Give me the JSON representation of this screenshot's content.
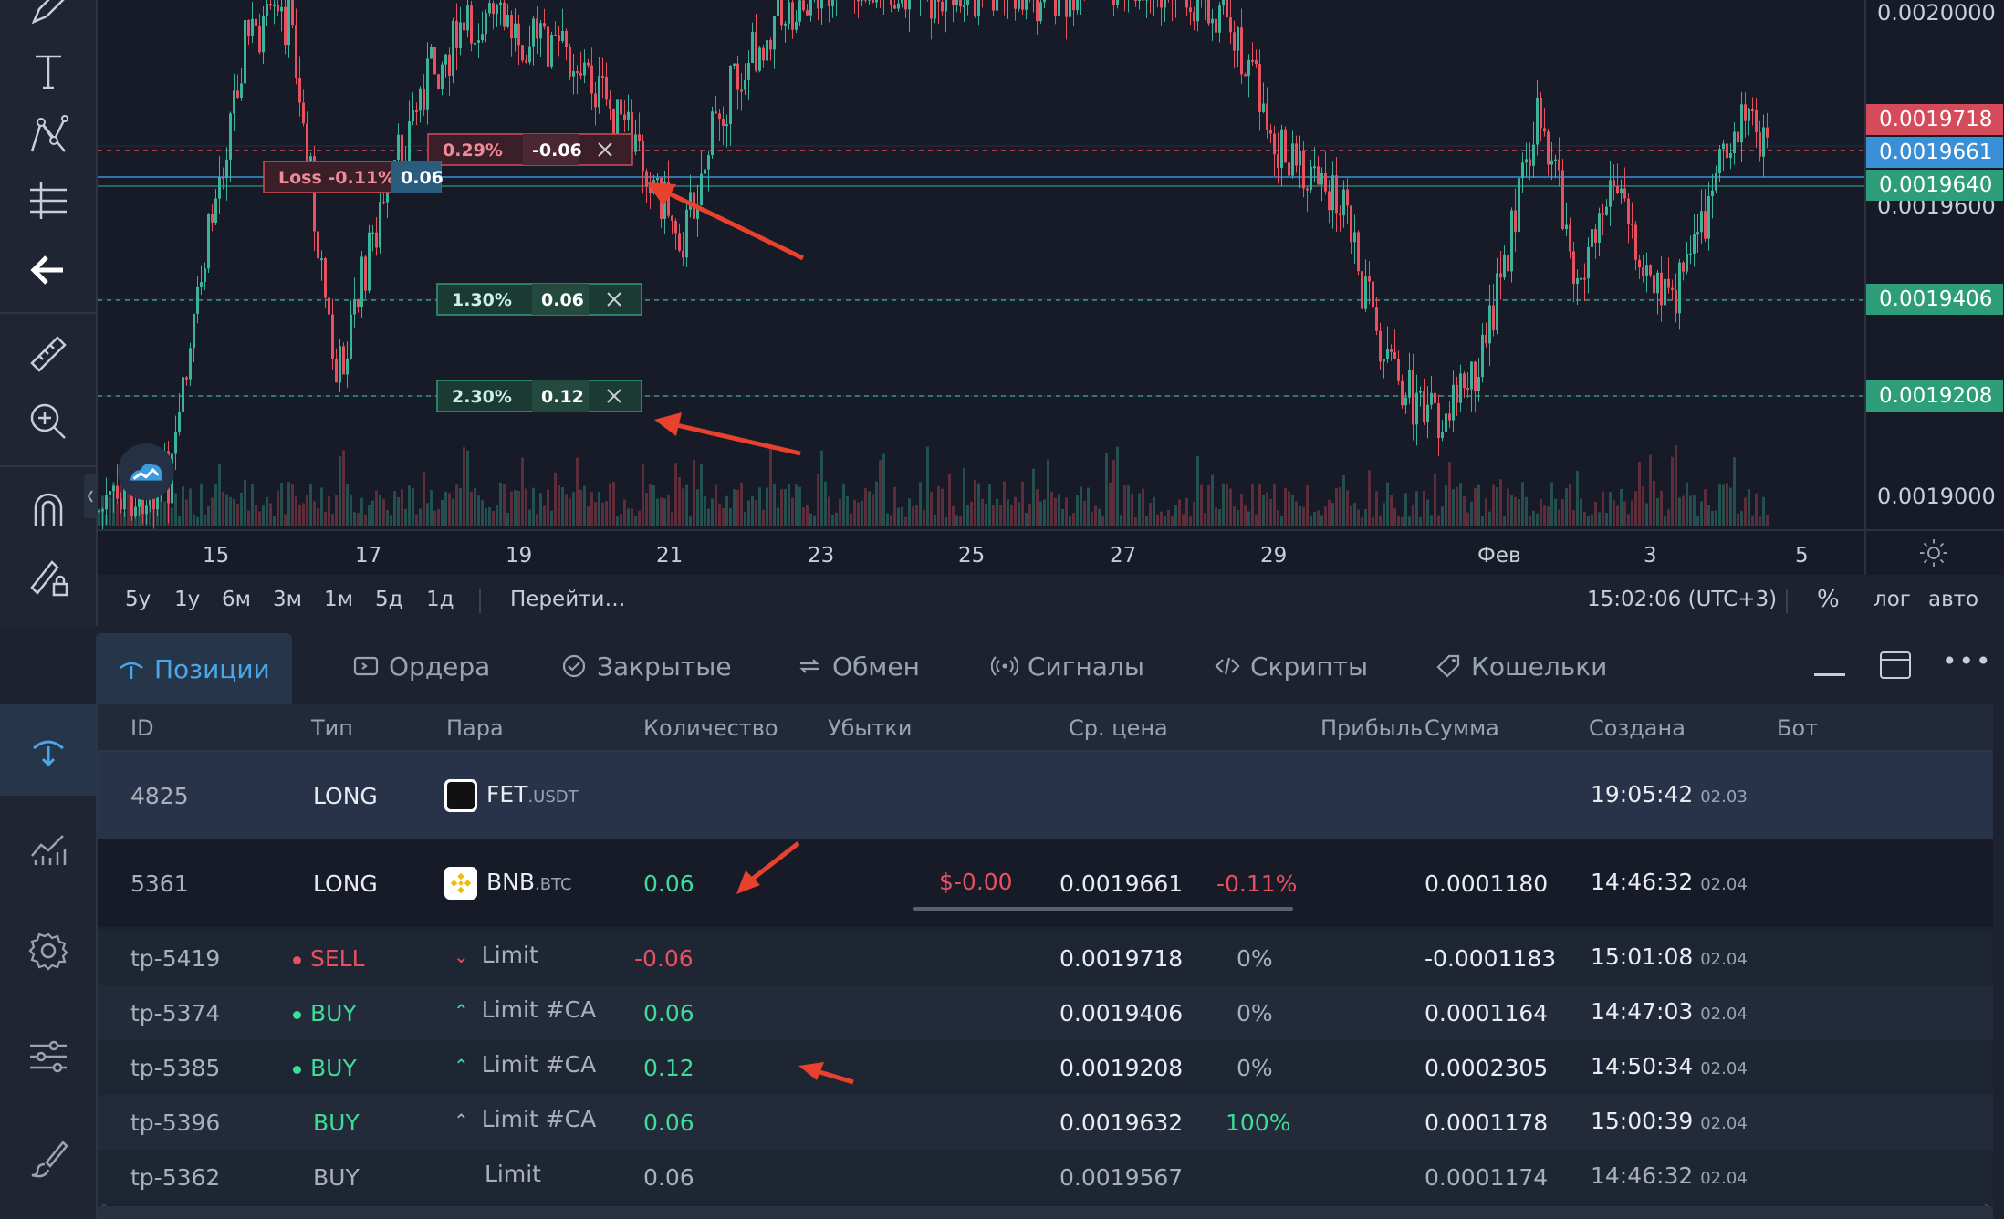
{
  "chart": {
    "price_labels": [
      "0.0020000",
      "0.0019600",
      "0.0019000"
    ],
    "price_tags": [
      {
        "value": "0.0019718",
        "color": "#d64b5b"
      },
      {
        "value": "0.0019661",
        "color": "#3a8fd6"
      },
      {
        "value": "0.0019640",
        "color": "#2e9e7a"
      },
      {
        "value": "0.0019406",
        "color": "#2e9e7a"
      },
      {
        "value": "0.0019208",
        "color": "#2e9e7a"
      }
    ],
    "time_labels": [
      "15",
      "17",
      "19",
      "21",
      "23",
      "25",
      "27",
      "29",
      "Фев",
      "3",
      "5"
    ],
    "orders": [
      {
        "pct": "0.29%",
        "qty": "-0.06",
        "kind": "sell"
      },
      {
        "pct": "Loss -0.11%",
        "qty": "0.06",
        "kind": "loss"
      },
      {
        "pct": "1.30%",
        "qty": "0.06",
        "kind": "tp"
      },
      {
        "pct": "2.30%",
        "qty": "0.12",
        "kind": "tp"
      }
    ],
    "colors": {
      "up": "#3bb39a",
      "down": "#e6505f",
      "bg": "#161b27"
    }
  },
  "rangebar": {
    "ranges": [
      "5y",
      "1y",
      "6м",
      "3м",
      "1м",
      "5д",
      "1д"
    ],
    "goto": "Перейти…",
    "time": "15:02:06 (UTC+3)",
    "percent": "%",
    "log": "лог",
    "auto": "авто"
  },
  "tabs": [
    "Позиции",
    "Ордера",
    "Закрытые",
    "Обмен",
    "Сигналы",
    "Скрипты",
    "Кошельки"
  ],
  "table": {
    "headers": [
      "ID",
      "Тип",
      "Пара",
      "Количество",
      "Убытки",
      "Ср. цена",
      "Прибыль",
      "Сумма",
      "Создана",
      "Бот"
    ],
    "positions": [
      {
        "id": "4825",
        "type": "LONG",
        "pair": "FET",
        "quote": ".USDT",
        "qty": "",
        "loss": "",
        "avg": "",
        "profit": "",
        "sum": "",
        "time": "19:05:42",
        "date": "02.03"
      },
      {
        "id": "5361",
        "type": "LONG",
        "pair": "BNB",
        "quote": ".BTC",
        "qty": "0.06",
        "loss": "$-0.00",
        "avg": "0.0019661",
        "profit": "-0.11%",
        "sum": "0.0001180",
        "time": "14:46:32",
        "date": "02.04"
      }
    ],
    "orders": [
      {
        "id": "tp-5419",
        "side": "SELL",
        "kind": "Limit",
        "qty": "-0.06",
        "price": "0.0019718",
        "pct": "0%",
        "sum": "-0.0001183",
        "time": "15:01:08",
        "date": "02.04"
      },
      {
        "id": "tp-5374",
        "side": "BUY",
        "kind": "Limit #CA",
        "qty": "0.06",
        "price": "0.0019406",
        "pct": "0%",
        "sum": "0.0001164",
        "time": "14:47:03",
        "date": "02.04"
      },
      {
        "id": "tp-5385",
        "side": "BUY",
        "kind": "Limit #CA",
        "qty": "0.12",
        "price": "0.0019208",
        "pct": "0%",
        "sum": "0.0002305",
        "time": "14:50:34",
        "date": "02.04"
      },
      {
        "id": "tp-5396",
        "side": "BUY",
        "kind": "Limit #CA",
        "qty": "0.06",
        "price": "0.0019632",
        "pct": "100%",
        "sum": "0.0001178",
        "time": "15:00:39",
        "date": "02.04"
      },
      {
        "id": "tp-5362",
        "side": "BUY",
        "kind": "Limit",
        "qty": "0.06",
        "price": "0.0019567",
        "pct": "",
        "sum": "0.0001174",
        "time": "14:46:32",
        "date": "02.04"
      }
    ]
  }
}
